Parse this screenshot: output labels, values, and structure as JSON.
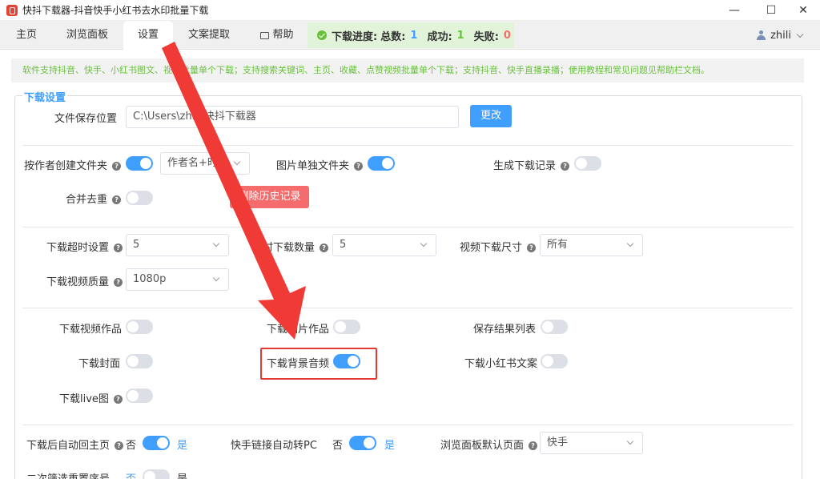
{
  "window": {
    "title": "快抖下载器-抖音快手小红书去水印批量下载",
    "minimize_symbol": "—",
    "maximize_symbol": "☐",
    "close_symbol": "✕"
  },
  "tabs": [
    {
      "label": "主页"
    },
    {
      "label": "浏览面板"
    },
    {
      "label": "设置"
    },
    {
      "label": "文案提取"
    },
    {
      "label": "帮助"
    }
  ],
  "progress": {
    "label": "下载进度:",
    "total_label": "总数:",
    "total": "1",
    "success_label": "成功:",
    "success": "1",
    "fail_label": "失败:",
    "fail": "0"
  },
  "user": {
    "name": "zhili"
  },
  "notice": "软件支持抖音、快手、小红书图文、视频批量单个下载；支持搜索关键词、主页、收藏、点赞视频批量单个下载；支持抖音、快手直播录播；使用教程和常见问题见帮助栏文档。",
  "section_title": "下载设置",
  "save_path": {
    "label": "文件保存位置",
    "value": "C:\\Users\\zhili\\快抖下载器",
    "change_button": "更改"
  },
  "folder_row": {
    "author_folder_label": "按作者创建文件夹",
    "author_folder_on": true,
    "folder_naming_value": "作者名+时间",
    "image_folder_label": "图片单独文件夹",
    "image_folder_on": true,
    "record_label": "生成下载记录",
    "record_on": false
  },
  "dedupe": {
    "label": "合并去重",
    "on": false,
    "delete_history_button": "删除历史记录"
  },
  "download_params": {
    "timeout_label": "下载超时设置",
    "timeout_value": "5",
    "concurrent_label": "同时下载数量",
    "concurrent_value": "5",
    "size_label": "视频下载尺寸",
    "size_value": "所有",
    "quality_label": "下载视频质量",
    "quality_value": "1080p"
  },
  "content_toggles": {
    "video_label": "下载视频作品",
    "video_on": false,
    "image_label": "下载图片作品",
    "image_on": false,
    "save_list_label": "保存结果列表",
    "save_list_on": false,
    "cover_label": "下载封面",
    "cover_on": false,
    "bgm_label": "下载背景音频",
    "bgm_on": true,
    "xhs_text_label": "下载小红书文案",
    "xhs_text_on": false,
    "live_label": "下载live图",
    "live_on": false
  },
  "behavior": {
    "auto_home_label": "下载后自动回主页",
    "auto_home_on": true,
    "ks_pc_label": "快手链接自动转PC",
    "ks_pc_on": true,
    "default_page_label": "浏览面板默认页面",
    "default_page_value": "快手",
    "renumber_label": "二次筛选重置序号",
    "renumber_on": false,
    "no_text": "否",
    "yes_text": "是"
  },
  "colors": {
    "accent": "#409eff",
    "success": "#67c23a",
    "danger": "#f56c6c",
    "annotation": "#e53935"
  }
}
